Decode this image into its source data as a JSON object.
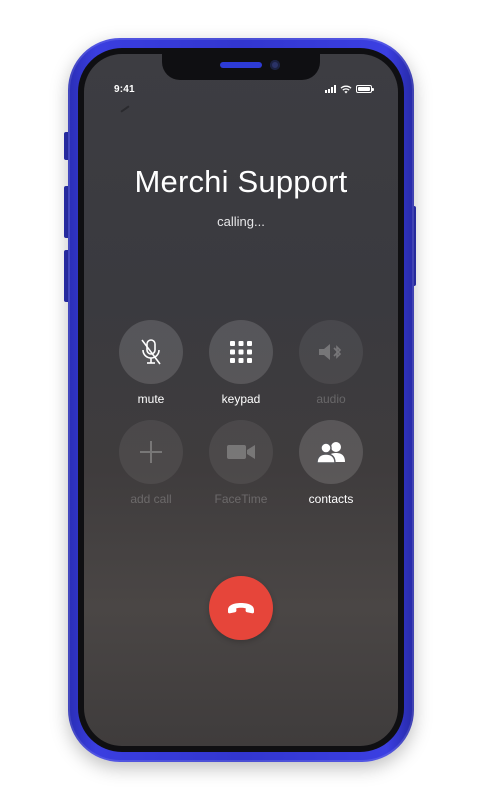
{
  "status_bar": {
    "time": "9:41",
    "icons": [
      "signal-icon",
      "wifi-icon",
      "battery-icon"
    ]
  },
  "call": {
    "caller_name": "Merchi Support",
    "status": "calling..."
  },
  "controls": [
    {
      "label": "mute",
      "icon": "microphone-muted-icon",
      "enabled": true
    },
    {
      "label": "keypad",
      "icon": "keypad-icon",
      "enabled": true
    },
    {
      "label": "audio",
      "icon": "speaker-bluetooth-icon",
      "enabled": false
    },
    {
      "label": "add call",
      "icon": "plus-icon",
      "enabled": false
    },
    {
      "label": "FaceTime",
      "icon": "video-camera-icon",
      "enabled": false
    },
    {
      "label": "contacts",
      "icon": "contacts-icon",
      "enabled": true
    }
  ],
  "end_call": {
    "icon": "hang-up-phone-icon"
  },
  "colors": {
    "device_frame": "#3236cf",
    "end_call": "#e6453a",
    "screen_bg": "#3d3d42"
  }
}
